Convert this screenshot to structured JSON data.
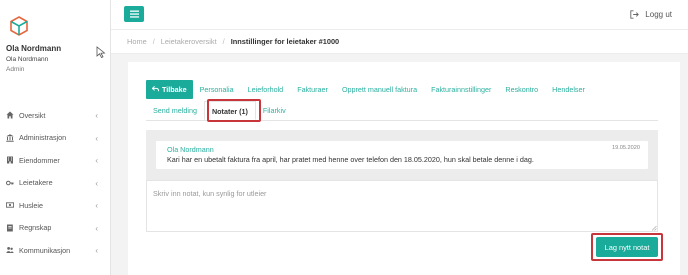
{
  "colors": {
    "accent": "#1aab9b",
    "highlight": "#c8353a",
    "link": "#2bb0a0"
  },
  "sidebar": {
    "logo_icon": "cube-logo-icon",
    "user": {
      "name": "Ola Nordmann",
      "subtitle": "Ola Nordmann",
      "role": "Admin"
    },
    "items": [
      {
        "label": "Oversikt",
        "icon": "home-icon"
      },
      {
        "label": "Administrasjon",
        "icon": "bank-icon"
      },
      {
        "label": "Eiendommer",
        "icon": "building-icon"
      },
      {
        "label": "Leietakere",
        "icon": "key-icon"
      },
      {
        "label": "Husleie",
        "icon": "money-icon"
      },
      {
        "label": "Regnskap",
        "icon": "book-icon"
      },
      {
        "label": "Kommunikasjon",
        "icon": "people-icon"
      }
    ]
  },
  "header": {
    "menu_icon": "hamburger-icon",
    "logout_label": "Logg ut",
    "logout_icon": "sign-out-icon"
  },
  "breadcrumb": {
    "home": "Home",
    "parent": "Leietakeroversikt",
    "current": "Innstillinger for leietaker #1000",
    "separator": "/"
  },
  "tabs": {
    "row1": [
      "Tilbake",
      "Personalia",
      "Leieforhold",
      "Fakturaer",
      "Opprett manuell faktura",
      "Fakturainnstillinger",
      "Reskontro",
      "Hendelser"
    ],
    "row2": [
      "Send melding",
      "Notater (1)",
      "Filarkiv"
    ],
    "active": "Tilbake",
    "selected": "Notater (1)"
  },
  "notes": [
    {
      "author": "Ola Nordmann",
      "date": "19.05.2020",
      "text": "Kari har en ubetalt faktura fra april, har pratet med henne over telefon den 18.05.2020, hun skal betale denne i dag."
    }
  ],
  "note_input": {
    "placeholder": "Skriv inn notat, kun synlig for utleier",
    "value": ""
  },
  "submit_label": "Lag nytt notat"
}
